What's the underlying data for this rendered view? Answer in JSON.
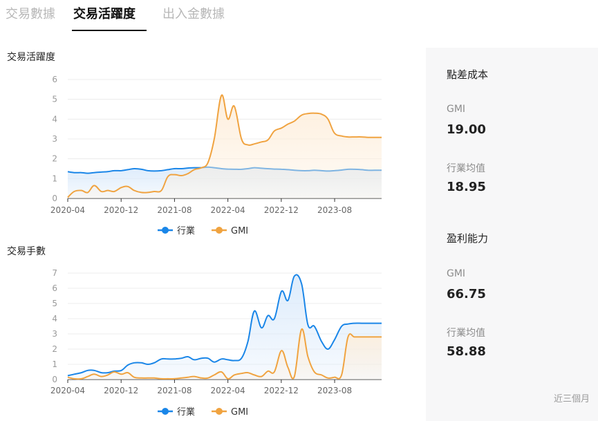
{
  "tabs": [
    {
      "label": "交易數據",
      "active": false
    },
    {
      "label": "交易活躍度",
      "active": true
    },
    {
      "label": "出入金數據",
      "active": false
    }
  ],
  "colors": {
    "industry": "#1a86e8",
    "gmi": "#f0a340",
    "industry_fill": "#dcebfb",
    "gmi_fill": "#fdeedb",
    "grid": "#ececec",
    "axis": "#333333"
  },
  "legend": {
    "industry": "行業",
    "gmi": "GMI"
  },
  "chart_data": [
    {
      "type": "area",
      "title": "交易活躍度",
      "ylim": [
        0,
        6
      ],
      "yticks": [
        0,
        1,
        2,
        3,
        4,
        5,
        6
      ],
      "xlim": [
        2020.25,
        2024.17
      ],
      "xticks": [
        "2020-04",
        "2020-12",
        "2021-08",
        "2022-04",
        "2022-12",
        "2023-08"
      ],
      "grid": true,
      "legend_position": "bottom",
      "series": [
        {
          "name": "行業",
          "x": [
            2020.25,
            2020.33,
            2020.42,
            2020.5,
            2020.58,
            2020.67,
            2020.75,
            2020.83,
            2020.92,
            2021.0,
            2021.08,
            2021.17,
            2021.25,
            2021.33,
            2021.42,
            2021.5,
            2021.58,
            2021.67,
            2021.75,
            2021.83,
            2021.92,
            2022.0,
            2022.08,
            2022.17,
            2022.25,
            2022.33,
            2022.42,
            2022.5,
            2022.58,
            2022.67,
            2022.75,
            2022.83,
            2022.92,
            2023.0,
            2023.08,
            2023.17,
            2023.25,
            2023.33,
            2023.42,
            2023.5,
            2023.58,
            2023.67,
            2023.75,
            2023.83,
            2023.92,
            2024.0,
            2024.08,
            2024.17
          ],
          "values": [
            1.35,
            1.3,
            1.3,
            1.27,
            1.3,
            1.33,
            1.35,
            1.4,
            1.4,
            1.45,
            1.5,
            1.47,
            1.4,
            1.38,
            1.4,
            1.45,
            1.5,
            1.5,
            1.53,
            1.55,
            1.55,
            1.58,
            1.55,
            1.5,
            1.48,
            1.47,
            1.47,
            1.5,
            1.55,
            1.52,
            1.5,
            1.48,
            1.47,
            1.45,
            1.42,
            1.4,
            1.4,
            1.42,
            1.4,
            1.38,
            1.4,
            1.43,
            1.47,
            1.47,
            1.45,
            1.42,
            1.42,
            1.42
          ]
        },
        {
          "name": "GMI",
          "x": [
            2020.25,
            2020.33,
            2020.42,
            2020.5,
            2020.58,
            2020.67,
            2020.75,
            2020.83,
            2020.92,
            2021.0,
            2021.08,
            2021.17,
            2021.25,
            2021.33,
            2021.42,
            2021.5,
            2021.58,
            2021.67,
            2021.75,
            2021.83,
            2021.92,
            2022.0,
            2022.08,
            2022.17,
            2022.25,
            2022.33,
            2022.42,
            2022.5,
            2022.58,
            2022.67,
            2022.75,
            2022.83,
            2022.92,
            2023.0,
            2023.08,
            2023.17,
            2023.25,
            2023.33,
            2023.42,
            2023.5,
            2023.58,
            2023.67,
            2023.75,
            2023.83,
            2023.92,
            2024.0,
            2024.08,
            2024.17
          ],
          "values": [
            0.05,
            0.35,
            0.4,
            0.3,
            0.65,
            0.35,
            0.4,
            0.35,
            0.55,
            0.6,
            0.4,
            0.3,
            0.3,
            0.35,
            0.4,
            1.1,
            1.2,
            1.15,
            1.25,
            1.45,
            1.55,
            1.8,
            3.0,
            5.2,
            4.0,
            4.65,
            3.0,
            2.7,
            2.75,
            2.85,
            2.95,
            3.4,
            3.55,
            3.75,
            3.9,
            4.2,
            4.28,
            4.3,
            4.25,
            4.0,
            3.3,
            3.15,
            3.1,
            3.1,
            3.1,
            3.08,
            3.08,
            3.08
          ]
        }
      ]
    },
    {
      "type": "area",
      "title": "交易手數",
      "ylim": [
        0,
        7
      ],
      "yticks": [
        0,
        1,
        2,
        3,
        4,
        5,
        6,
        7
      ],
      "xlim": [
        2020.25,
        2024.17
      ],
      "xticks": [
        "2020-04",
        "2020-12",
        "2021-08",
        "2022-04",
        "2022-12",
        "2023-08"
      ],
      "grid": true,
      "legend_position": "bottom",
      "series": [
        {
          "name": "行業",
          "x": [
            2020.25,
            2020.33,
            2020.42,
            2020.5,
            2020.58,
            2020.67,
            2020.75,
            2020.83,
            2020.92,
            2021.0,
            2021.08,
            2021.17,
            2021.25,
            2021.33,
            2021.42,
            2021.5,
            2021.58,
            2021.67,
            2021.75,
            2021.83,
            2021.92,
            2022.0,
            2022.08,
            2022.17,
            2022.25,
            2022.33,
            2022.42,
            2022.5,
            2022.58,
            2022.67,
            2022.75,
            2022.83,
            2022.92,
            2023.0,
            2023.08,
            2023.17,
            2023.25,
            2023.33,
            2023.42,
            2023.5,
            2023.58,
            2023.67,
            2023.75,
            2023.83,
            2023.92,
            2024.0,
            2024.08,
            2024.17
          ],
          "values": [
            0.25,
            0.35,
            0.45,
            0.6,
            0.6,
            0.45,
            0.45,
            0.55,
            0.6,
            0.95,
            1.1,
            1.1,
            1.0,
            1.1,
            1.35,
            1.35,
            1.35,
            1.4,
            1.5,
            1.3,
            1.4,
            1.4,
            1.15,
            1.35,
            1.3,
            1.25,
            1.4,
            2.5,
            4.5,
            3.4,
            4.2,
            4.0,
            5.8,
            5.2,
            6.8,
            6.3,
            3.6,
            3.5,
            2.5,
            2.0,
            2.6,
            3.5,
            3.65,
            3.7,
            3.7,
            3.7,
            3.7,
            3.7
          ]
        },
        {
          "name": "GMI",
          "x": [
            2020.25,
            2020.33,
            2020.42,
            2020.5,
            2020.58,
            2020.67,
            2020.75,
            2020.83,
            2020.92,
            2021.0,
            2021.08,
            2021.17,
            2021.25,
            2021.33,
            2021.42,
            2021.5,
            2021.58,
            2021.67,
            2021.75,
            2021.83,
            2021.92,
            2022.0,
            2022.08,
            2022.17,
            2022.25,
            2022.33,
            2022.42,
            2022.5,
            2022.58,
            2022.67,
            2022.75,
            2022.83,
            2022.92,
            2023.0,
            2023.08,
            2023.17,
            2023.25,
            2023.33,
            2023.42,
            2023.5,
            2023.58,
            2023.67,
            2023.75,
            2023.83,
            2023.92,
            2024.0,
            2024.08,
            2024.17
          ],
          "values": [
            0.15,
            0.05,
            0.05,
            0.2,
            0.35,
            0.2,
            0.3,
            0.5,
            0.35,
            0.45,
            0.15,
            0.1,
            0.1,
            0.1,
            0.05,
            0.05,
            0.05,
            0.1,
            0.15,
            0.2,
            0.1,
            0.1,
            0.3,
            0.5,
            0.05,
            0.3,
            0.4,
            0.45,
            0.3,
            0.2,
            0.55,
            0.5,
            1.9,
            0.8,
            0.2,
            3.3,
            1.5,
            0.5,
            0.3,
            0.1,
            0.15,
            0.3,
            2.8,
            2.8,
            2.8,
            2.8,
            2.8,
            2.8
          ]
        }
      ]
    }
  ],
  "side_panel": {
    "sections": [
      {
        "heading": "點差成本",
        "rows": [
          {
            "label": "GMI",
            "value": "19.00"
          },
          {
            "label": "行業均值",
            "value": "18.95"
          }
        ]
      },
      {
        "heading": "盈利能力",
        "rows": [
          {
            "label": "GMI",
            "value": "66.75"
          },
          {
            "label": "行業均值",
            "value": "58.88"
          }
        ]
      }
    ],
    "footnote": "近三個月"
  }
}
